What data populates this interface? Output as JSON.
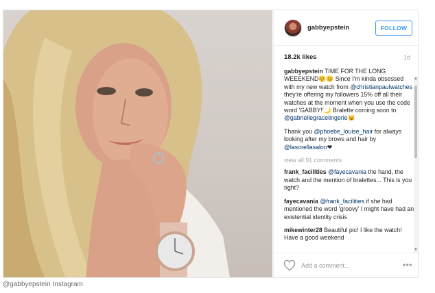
{
  "post": {
    "username": "gabbyepstein",
    "follow_label": "FOLLOW",
    "likes": "18.2k likes",
    "age": "1d",
    "caption": {
      "user": "gabbyepstein",
      "text_1": "TIME FOR THE LONG WEEEKEND😊😊 Since I'm kinda obsessed with my new watch from ",
      "mention_1": "@christianpaulwatches",
      "text_2": " they're offering my followers 15% off all their watches at the moment when you use the code word 'GABBY!'🌙 Bralette coming soon to ",
      "mention_2": "@gabriellegracelingerie",
      "text_3": "😼"
    },
    "thanks": {
      "text_1": "Thank you ",
      "mention_1": "@phoebe_louise_hair",
      "text_2": " for always looking after my brows and hair by ",
      "mention_2": "@lasorellasalon",
      "text_3": "❤"
    },
    "view_all": "view all 91 comments",
    "comments": [
      {
        "user": "frank_facilities",
        "mention": "@fayecavania",
        "text": " the hand, the watch and the mention of bralettes... This is you right?"
      },
      {
        "user": "fayecavania",
        "mention": "@frank_facilities",
        "text": " if she had mentioned the word 'groovy' I might have had an existential identity crisis"
      },
      {
        "user": "mikewinter28",
        "mention": "",
        "text": " Beautiful pic! I like the watch! Have a good weekend"
      }
    ],
    "add_comment_placeholder": "Add a comment...",
    "icons": {
      "like": "heart-icon",
      "more": "more-options-icon",
      "avatar": "avatar"
    }
  },
  "credit": "@gabbyepstein Instagram"
}
